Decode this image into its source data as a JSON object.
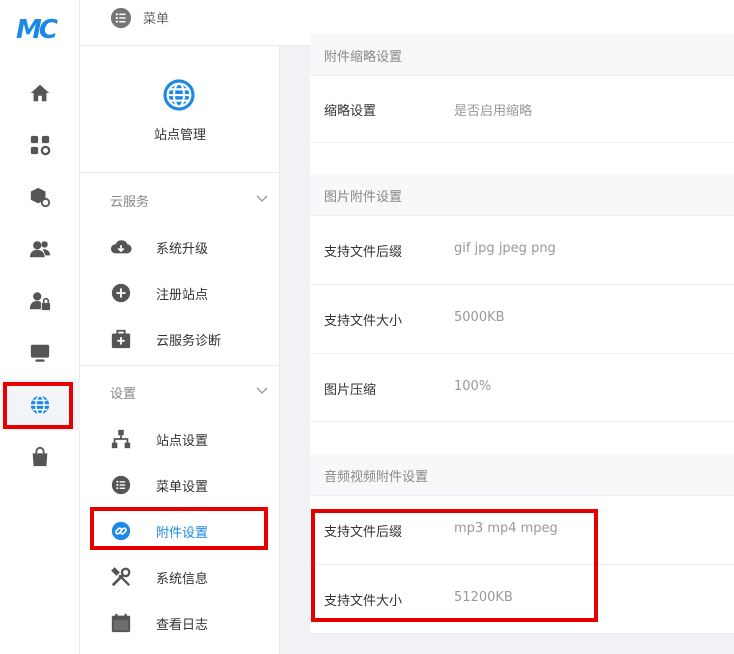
{
  "brand": {
    "logo_text": "MC",
    "logo_color": "#1e88e5"
  },
  "rail": {
    "items": [
      {
        "icon": "home-icon"
      },
      {
        "icon": "apps-settings-icon"
      },
      {
        "icon": "package-settings-icon"
      },
      {
        "icon": "users-icon"
      },
      {
        "icon": "user-lock-icon"
      },
      {
        "icon": "monitor-icon"
      },
      {
        "icon": "globe-icon",
        "active": true
      },
      {
        "icon": "shopping-bag-icon"
      }
    ]
  },
  "topbar": {
    "menu_label": "菜单"
  },
  "sidebar": {
    "site_title": "站点管理",
    "groups": [
      {
        "label": "云服务",
        "items": [
          {
            "label": "系统升级",
            "icon": "cloud-download-icon"
          },
          {
            "label": "注册站点",
            "icon": "plus-circle-icon"
          },
          {
            "label": "云服务诊断",
            "icon": "medical-kit-icon"
          }
        ]
      },
      {
        "label": "设置",
        "items": [
          {
            "label": "站点设置",
            "icon": "sitemap-icon"
          },
          {
            "label": "菜单设置",
            "icon": "list-icon"
          },
          {
            "label": "附件设置",
            "icon": "link-icon",
            "active": true
          },
          {
            "label": "系统信息",
            "icon": "tools-icon"
          },
          {
            "label": "查看日志",
            "icon": "calendar-icon"
          }
        ]
      }
    ]
  },
  "main": {
    "sections": [
      {
        "title": "附件缩略设置",
        "rows": [
          {
            "label": "缩略设置",
            "value": "是否启用缩略"
          }
        ]
      },
      {
        "title": "图片附件设置",
        "rows": [
          {
            "label": "支持文件后缀",
            "value": "gif jpg jpeg png"
          },
          {
            "label": "支持文件大小",
            "value": "5000KB"
          },
          {
            "label": "图片压缩",
            "value": "100%"
          }
        ]
      },
      {
        "title": "音频视频附件设置",
        "rows": [
          {
            "label": "支持文件后缀",
            "value": "mp3 mp4 mpeg"
          },
          {
            "label": "支持文件大小",
            "value": "51200KB"
          }
        ]
      }
    ]
  },
  "colors": {
    "accent": "#1e88e5",
    "highlight": "#e60000",
    "icon_gray": "#555555"
  }
}
